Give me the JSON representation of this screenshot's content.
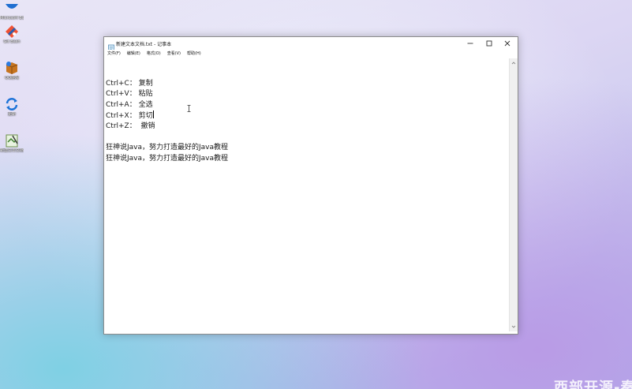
{
  "desktop": {
    "icons": [
      {
        "label": "Microsoft Edge"
      },
      {
        "label": "Git Bash"
      },
      {
        "label": "QQ游戏"
      },
      {
        "label": "更新"
      },
      {
        "label": "新建文本文档 .txt"
      }
    ],
    "watermark": "西部开源-秦"
  },
  "notepad": {
    "title": "新建文本文档.txt - 记事本",
    "menus": [
      "文件(F)",
      "编辑(E)",
      "格式(O)",
      "查看(V)",
      "帮助(H)"
    ],
    "lines": [
      "",
      "Ctrl+C： 复制",
      "Ctrl+V： 粘贴",
      "Ctrl+A： 全选",
      "Ctrl+X： 剪切",
      "Ctrl+Z：  撤销",
      "",
      "狂神说Java，努力打造最好的Java教程",
      "狂神说Java，努力打造最好的Java教程"
    ]
  },
  "colors": {
    "window_border": "#8c8c8c",
    "text": "#1a1a1a",
    "scrollbar": "#f0f0f0"
  }
}
